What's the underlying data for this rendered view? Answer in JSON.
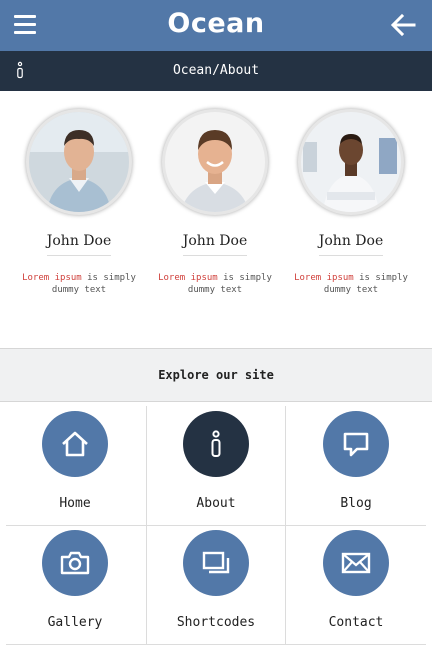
{
  "header": {
    "logo_text": "Ocean",
    "menu_icon": "hamburger-menu-icon",
    "back_icon": "arrow-left-icon",
    "bar_color": "#5278a8"
  },
  "breadcrumb": {
    "text": "Ocean/About",
    "icon": "info-icon",
    "bar_color": "#243243"
  },
  "team": [
    {
      "name": "John Doe",
      "desc_highlight": "Lorem ipsum",
      "desc_rest": " is simply dummy text"
    },
    {
      "name": "John Doe",
      "desc_highlight": "Lorem ipsum",
      "desc_rest": " is simply dummy text"
    },
    {
      "name": "John Doe",
      "desc_highlight": "Lorem ipsum",
      "desc_rest": " is simply dummy text"
    }
  ],
  "explore": {
    "title": "Explore our site"
  },
  "nav": [
    {
      "label": "Home",
      "icon": "home-icon"
    },
    {
      "label": "About",
      "icon": "info-icon",
      "active": true
    },
    {
      "label": "Blog",
      "icon": "speech-bubble-icon"
    },
    {
      "label": "Gallery",
      "icon": "camera-icon"
    },
    {
      "label": "Shortcodes",
      "icon": "windows-icon"
    },
    {
      "label": "Contact",
      "icon": "envelope-icon"
    }
  ],
  "colors": {
    "accent": "#5278a8",
    "dark": "#243243",
    "highlight": "#d0413c"
  }
}
